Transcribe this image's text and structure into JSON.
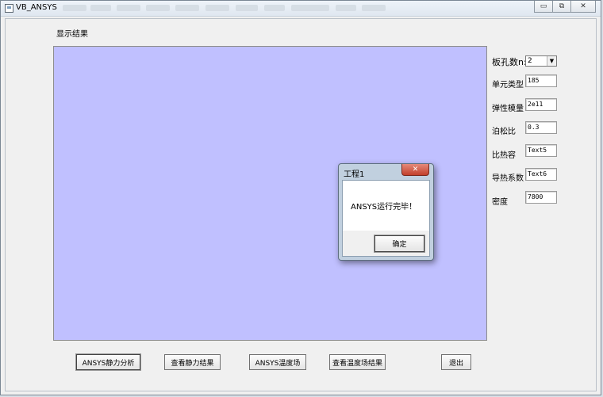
{
  "window": {
    "title": "VB_ANSYS"
  },
  "caption": {
    "minimize": "▭",
    "restore": "⧉",
    "close": "✕"
  },
  "form": {
    "result_label": "显示结果"
  },
  "fields": {
    "hole_count": {
      "label": "板孔数n:",
      "value": "2"
    },
    "element_type": {
      "label": "单元类型",
      "value": "185"
    },
    "elastic_modulus": {
      "label": "弹性模量",
      "value": "2e11"
    },
    "poisson_ratio": {
      "label": "泊松比",
      "value": "0.3"
    },
    "specific_heat": {
      "label": "比热容",
      "value": "Text5"
    },
    "thermal_conductivity": {
      "label": "导热系数",
      "value": "Text6"
    },
    "density": {
      "label": "密度",
      "value": "7800"
    }
  },
  "buttons": {
    "static_analysis": "ANSYS静力分析",
    "view_static": "查看静力结果",
    "temp_field": "ANSYS温度场",
    "view_temp": "查看温度场结果",
    "exit": "退出"
  },
  "dialog": {
    "title": "工程1",
    "message": "ANSYS运行完毕！",
    "ok": "确定",
    "close_glyph": "✕"
  },
  "colors": {
    "plot_background": "#c0c0ff",
    "close_button": "#c2402c"
  }
}
